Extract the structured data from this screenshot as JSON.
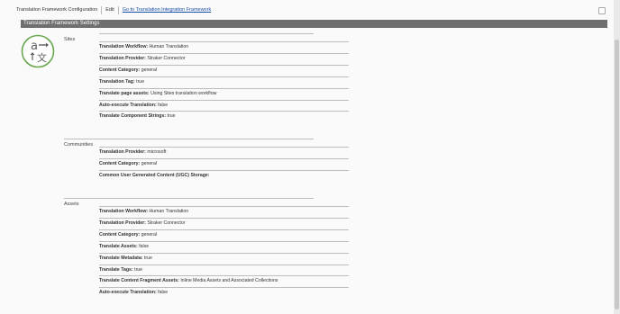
{
  "toolbar": {
    "title": "Translation Framework Configuration",
    "edit_label": "Edit",
    "link_label": "Go to Translation Integration Framework"
  },
  "header": {
    "title": "Translation Framework Settings"
  },
  "logo": {
    "icon": "translation-logo-icon",
    "glyph_latin": "a",
    "glyph_cjk": "文",
    "color": "#6aa84f"
  },
  "sites": {
    "label": "Sites",
    "rows": [
      {
        "key": "Translation Workflow:",
        "value": "Human Translation"
      },
      {
        "key": "Translation Provider:",
        "value": "Straker Connector"
      },
      {
        "key": "Content Category:",
        "value": "general"
      },
      {
        "key": "Translation Tag:",
        "value": "true"
      },
      {
        "key": "Translate page assets:",
        "value": "Using Sites translation workflow"
      },
      {
        "key": "Auto-execute Translation:",
        "value": "false"
      },
      {
        "key": "Translate Component Strings:",
        "value": "true"
      }
    ]
  },
  "communities": {
    "label": "Communities",
    "rows": [
      {
        "key": "Translation Provider:",
        "value": "microsoft"
      },
      {
        "key": "Content Category:",
        "value": "general"
      },
      {
        "key": "Common User Generated Content (UGC) Storage:",
        "value": ""
      }
    ]
  },
  "assets": {
    "label": "Assets",
    "rows": [
      {
        "key": "Translation Workflow:",
        "value": "Human Translation"
      },
      {
        "key": "Translation Provider:",
        "value": "Straker Connector"
      },
      {
        "key": "Content Category:",
        "value": "general"
      },
      {
        "key": "Translate Assets:",
        "value": "false"
      },
      {
        "key": "Translate Metadata:",
        "value": "true"
      },
      {
        "key": "Translate Tags:",
        "value": "true"
      },
      {
        "key": "Translate Content Fragment Assets:",
        "value": "Inline Media Assets and Associated Collections"
      },
      {
        "key": "Auto-execute Translation:",
        "value": "false"
      }
    ]
  }
}
